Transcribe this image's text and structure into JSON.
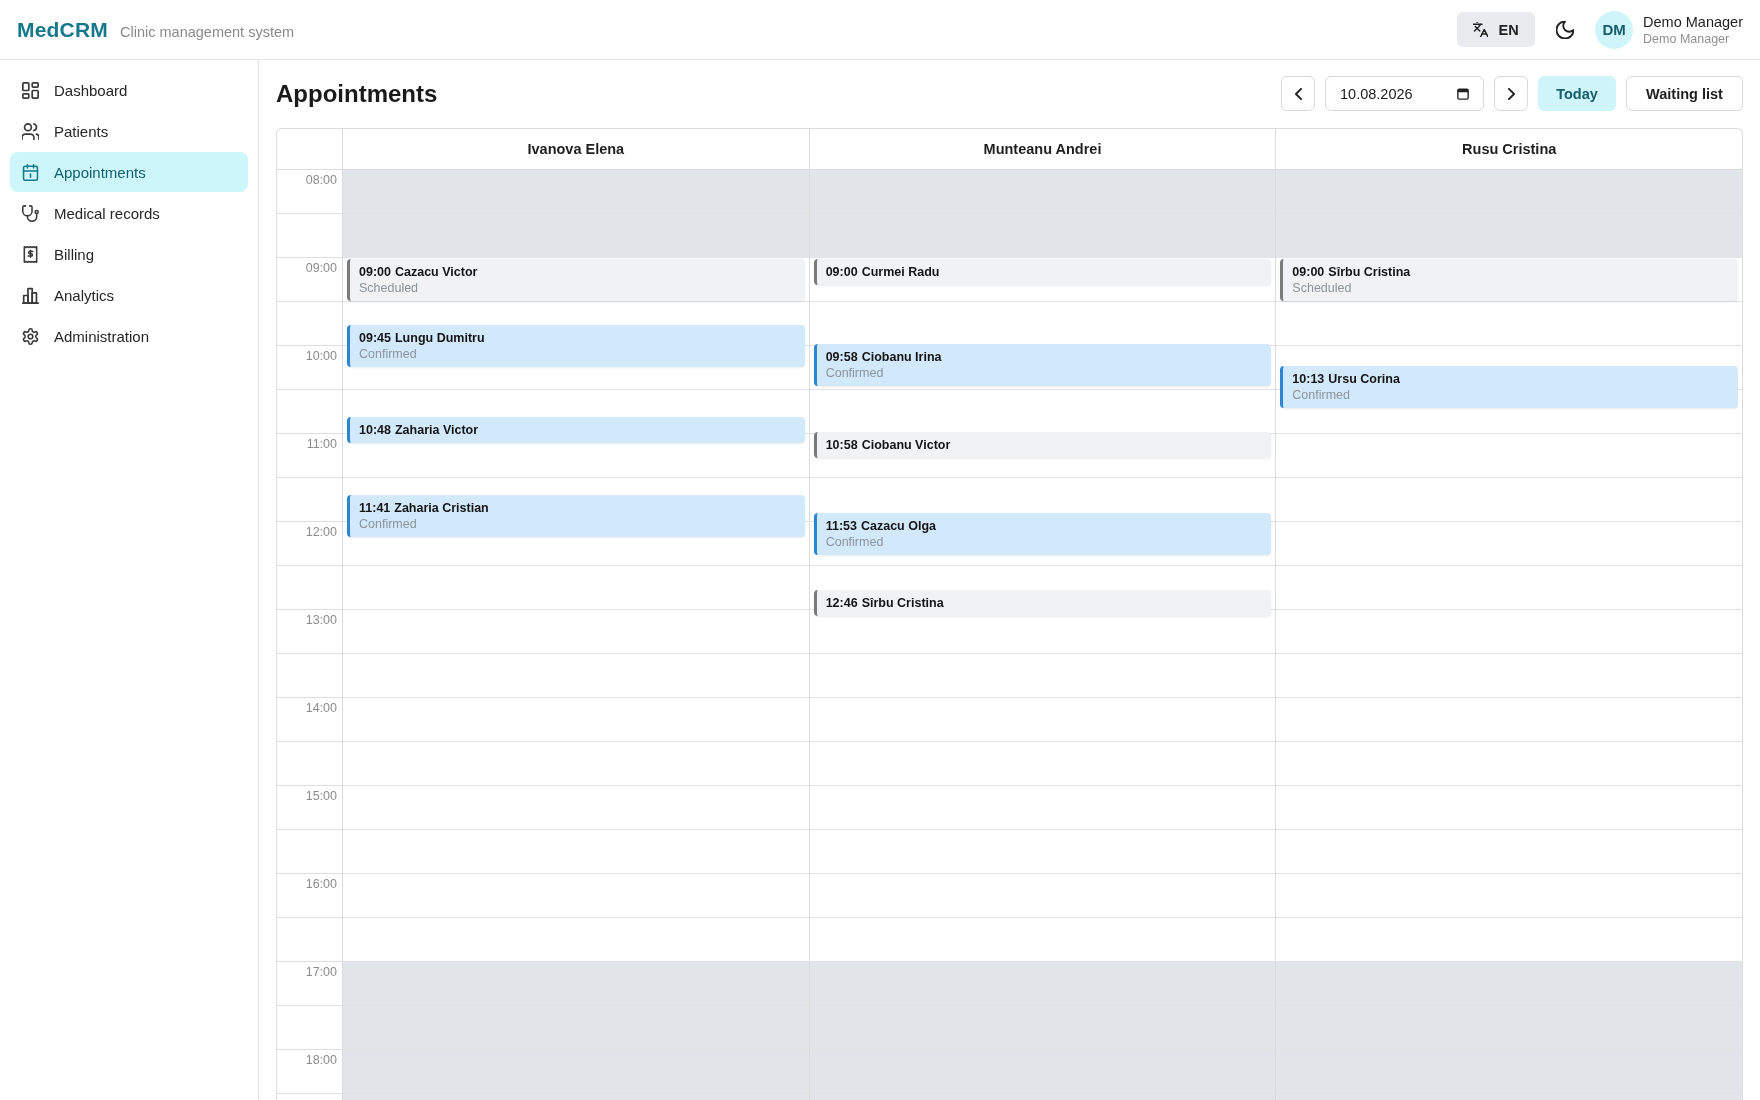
{
  "header": {
    "logo": "MedCRM",
    "subtitle": "Clinic management system",
    "language": "EN",
    "user": {
      "initials": "DM",
      "name": "Demo Manager",
      "role": "Demo Manager"
    }
  },
  "sidebar": {
    "items": [
      {
        "label": "Dashboard",
        "selected": false
      },
      {
        "label": "Patients",
        "selected": false
      },
      {
        "label": "Appointments",
        "selected": true
      },
      {
        "label": "Medical records",
        "selected": false
      },
      {
        "label": "Billing",
        "selected": false
      },
      {
        "label": "Analytics",
        "selected": false
      },
      {
        "label": "Administration",
        "selected": false
      }
    ]
  },
  "page": {
    "title": "Appointments",
    "date": "10.08.2026",
    "today_button": "Today",
    "waiting_list_button": "Waiting list"
  },
  "schedule": {
    "hours": [
      {
        "label": "08:00",
        "working": false
      },
      {
        "label": "09:00",
        "working": true
      },
      {
        "label": "10:00",
        "working": true
      },
      {
        "label": "11:00",
        "working": true
      },
      {
        "label": "12:00",
        "working": true
      },
      {
        "label": "13:00",
        "working": true
      },
      {
        "label": "14:00",
        "working": true
      },
      {
        "label": "15:00",
        "working": true
      },
      {
        "label": "16:00",
        "working": true
      },
      {
        "label": "17:00",
        "working": false
      },
      {
        "label": "18:00",
        "working": false
      }
    ],
    "columns": [
      {
        "doctor": "Ivanova Elena",
        "appointments": [
          {
            "time": "09:00",
            "patient": "Cazacu Victor",
            "kind": "scheduled",
            "status": "Scheduled"
          },
          {
            "time": "09:45",
            "patient": "Lungu Dumitru",
            "kind": "confirmed",
            "status": "Confirmed"
          },
          {
            "time": "10:48",
            "patient": "Zaharia Victor",
            "kind": "confirmed"
          },
          {
            "time": "11:41",
            "patient": "Zaharia Cristian",
            "kind": "confirmed",
            "status": "Confirmed"
          }
        ]
      },
      {
        "doctor": "Munteanu Andrei",
        "appointments": [
          {
            "time": "09:00",
            "patient": "Curmei Radu",
            "kind": "scheduled"
          },
          {
            "time": "09:58",
            "patient": "Ciobanu Irina",
            "kind": "confirmed",
            "status": "Confirmed"
          },
          {
            "time": "10:58",
            "patient": "Ciobanu Victor",
            "kind": "scheduled"
          },
          {
            "time": "11:53",
            "patient": "Cazacu Olga",
            "kind": "confirmed",
            "status": "Confirmed"
          },
          {
            "time": "12:46",
            "patient": "Sîrbu Cristina",
            "kind": "scheduled"
          }
        ]
      },
      {
        "doctor": "Rusu Cristina",
        "appointments": [
          {
            "time": "09:00",
            "patient": "Sîrbu Cristina",
            "kind": "scheduled",
            "status": "Scheduled"
          },
          {
            "time": "10:13",
            "patient": "Ursu Corina",
            "kind": "confirmed",
            "status": "Confirmed"
          }
        ]
      }
    ]
  }
}
